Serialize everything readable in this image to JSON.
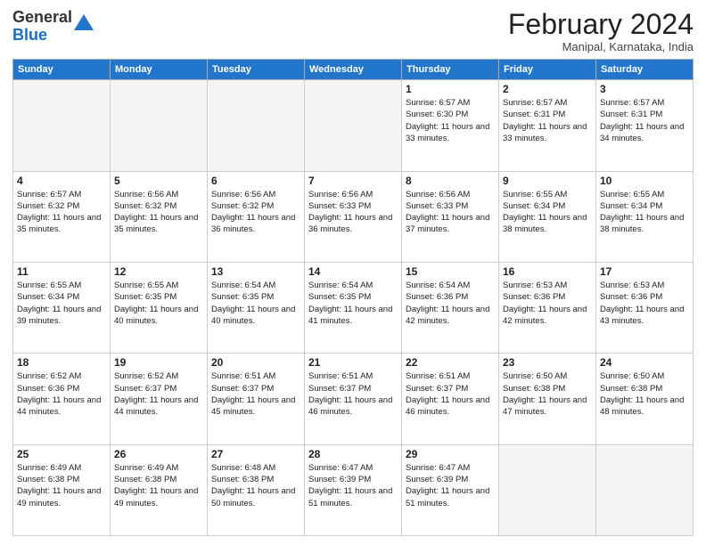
{
  "header": {
    "logo_line1": "General",
    "logo_line2": "Blue",
    "month_title": "February 2024",
    "location": "Manipal, Karnataka, India"
  },
  "days_of_week": [
    "Sunday",
    "Monday",
    "Tuesday",
    "Wednesday",
    "Thursday",
    "Friday",
    "Saturday"
  ],
  "weeks": [
    [
      {
        "day": "",
        "empty": true
      },
      {
        "day": "",
        "empty": true
      },
      {
        "day": "",
        "empty": true
      },
      {
        "day": "",
        "empty": true
      },
      {
        "day": "1",
        "sunrise": "6:57 AM",
        "sunset": "6:30 PM",
        "daylight": "11 hours and 33 minutes."
      },
      {
        "day": "2",
        "sunrise": "6:57 AM",
        "sunset": "6:31 PM",
        "daylight": "11 hours and 33 minutes."
      },
      {
        "day": "3",
        "sunrise": "6:57 AM",
        "sunset": "6:31 PM",
        "daylight": "11 hours and 34 minutes."
      }
    ],
    [
      {
        "day": "4",
        "sunrise": "6:57 AM",
        "sunset": "6:32 PM",
        "daylight": "11 hours and 35 minutes."
      },
      {
        "day": "5",
        "sunrise": "6:56 AM",
        "sunset": "6:32 PM",
        "daylight": "11 hours and 35 minutes."
      },
      {
        "day": "6",
        "sunrise": "6:56 AM",
        "sunset": "6:32 PM",
        "daylight": "11 hours and 36 minutes."
      },
      {
        "day": "7",
        "sunrise": "6:56 AM",
        "sunset": "6:33 PM",
        "daylight": "11 hours and 36 minutes."
      },
      {
        "day": "8",
        "sunrise": "6:56 AM",
        "sunset": "6:33 PM",
        "daylight": "11 hours and 37 minutes."
      },
      {
        "day": "9",
        "sunrise": "6:55 AM",
        "sunset": "6:34 PM",
        "daylight": "11 hours and 38 minutes."
      },
      {
        "day": "10",
        "sunrise": "6:55 AM",
        "sunset": "6:34 PM",
        "daylight": "11 hours and 38 minutes."
      }
    ],
    [
      {
        "day": "11",
        "sunrise": "6:55 AM",
        "sunset": "6:34 PM",
        "daylight": "11 hours and 39 minutes."
      },
      {
        "day": "12",
        "sunrise": "6:55 AM",
        "sunset": "6:35 PM",
        "daylight": "11 hours and 40 minutes."
      },
      {
        "day": "13",
        "sunrise": "6:54 AM",
        "sunset": "6:35 PM",
        "daylight": "11 hours and 40 minutes."
      },
      {
        "day": "14",
        "sunrise": "6:54 AM",
        "sunset": "6:35 PM",
        "daylight": "11 hours and 41 minutes."
      },
      {
        "day": "15",
        "sunrise": "6:54 AM",
        "sunset": "6:36 PM",
        "daylight": "11 hours and 42 minutes."
      },
      {
        "day": "16",
        "sunrise": "6:53 AM",
        "sunset": "6:36 PM",
        "daylight": "11 hours and 42 minutes."
      },
      {
        "day": "17",
        "sunrise": "6:53 AM",
        "sunset": "6:36 PM",
        "daylight": "11 hours and 43 minutes."
      }
    ],
    [
      {
        "day": "18",
        "sunrise": "6:52 AM",
        "sunset": "6:36 PM",
        "daylight": "11 hours and 44 minutes."
      },
      {
        "day": "19",
        "sunrise": "6:52 AM",
        "sunset": "6:37 PM",
        "daylight": "11 hours and 44 minutes."
      },
      {
        "day": "20",
        "sunrise": "6:51 AM",
        "sunset": "6:37 PM",
        "daylight": "11 hours and 45 minutes."
      },
      {
        "day": "21",
        "sunrise": "6:51 AM",
        "sunset": "6:37 PM",
        "daylight": "11 hours and 46 minutes."
      },
      {
        "day": "22",
        "sunrise": "6:51 AM",
        "sunset": "6:37 PM",
        "daylight": "11 hours and 46 minutes."
      },
      {
        "day": "23",
        "sunrise": "6:50 AM",
        "sunset": "6:38 PM",
        "daylight": "11 hours and 47 minutes."
      },
      {
        "day": "24",
        "sunrise": "6:50 AM",
        "sunset": "6:38 PM",
        "daylight": "11 hours and 48 minutes."
      }
    ],
    [
      {
        "day": "25",
        "sunrise": "6:49 AM",
        "sunset": "6:38 PM",
        "daylight": "11 hours and 49 minutes."
      },
      {
        "day": "26",
        "sunrise": "6:49 AM",
        "sunset": "6:38 PM",
        "daylight": "11 hours and 49 minutes."
      },
      {
        "day": "27",
        "sunrise": "6:48 AM",
        "sunset": "6:38 PM",
        "daylight": "11 hours and 50 minutes."
      },
      {
        "day": "28",
        "sunrise": "6:47 AM",
        "sunset": "6:39 PM",
        "daylight": "11 hours and 51 minutes."
      },
      {
        "day": "29",
        "sunrise": "6:47 AM",
        "sunset": "6:39 PM",
        "daylight": "11 hours and 51 minutes."
      },
      {
        "day": "",
        "empty": true
      },
      {
        "day": "",
        "empty": true
      }
    ]
  ]
}
